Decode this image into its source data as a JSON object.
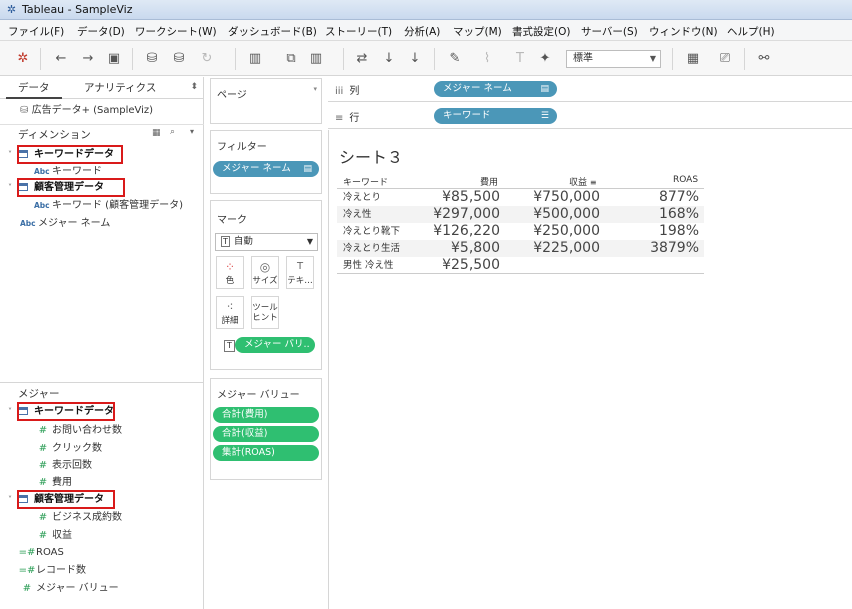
{
  "window": {
    "title": "Tableau - SampleViz"
  },
  "menu": [
    "ファイル(F)",
    "データ(D)",
    "ワークシート(W)",
    "ダッシュボード(B)",
    "ストーリー(T)",
    "分析(A)",
    "マップ(M)",
    "書式設定(O)",
    "サーバー(S)",
    "ウィンドウ(N)",
    "ヘルプ(H)"
  ],
  "toolbar": {
    "fit_mode": "標準"
  },
  "data_pane": {
    "tabs": [
      "データ",
      "アナリティクス"
    ],
    "datasource": "広告データ+ (SampleViz)",
    "dimensions_header": "ディメンション",
    "dimensions": {
      "table1": "キーワードデータ",
      "table1_field": "キーワード",
      "table2": "顧客管理データ",
      "table2_field": "キーワード (顧客管理データ)",
      "measure_names": "メジャー ネーム"
    },
    "measures_header": "メジャー",
    "measures": {
      "table1": "キーワードデータ",
      "table1_fields": [
        "お問い合わせ数",
        "クリック数",
        "表示回数",
        "費用"
      ],
      "table2": "顧客管理データ",
      "table2_fields": [
        "ビジネス成約数",
        "収益"
      ],
      "others": [
        "ROAS",
        "レコード数",
        "メジャー バリュー"
      ]
    }
  },
  "pages": {
    "title": "ページ"
  },
  "filters": {
    "title": "フィルター",
    "pill": "メジャー ネーム"
  },
  "marks": {
    "title": "マーク",
    "type": "自動",
    "buttons": {
      "color": "色",
      "size": "サイズ",
      "text": "テキ…",
      "detail": "詳細",
      "tooltip_1": "ツール",
      "tooltip_2": "ヒント"
    },
    "pill": "メジャー バリ.."
  },
  "measure_values_card": {
    "title": "メジャー バリュー",
    "pills": [
      "合計(費用)",
      "合計(収益)",
      "集計(ROAS)"
    ]
  },
  "shelves": {
    "columns_label": "列",
    "columns_pill": "メジャー ネーム",
    "rows_label": "行",
    "rows_pill": "キーワード"
  },
  "view": {
    "sheet_title": "シート３",
    "headers": {
      "keyword": "キーワード",
      "cost": "費用",
      "revenue": "収益",
      "roas": "ROAS"
    },
    "rows": [
      {
        "keyword": "冷えとり",
        "cost": "¥85,500",
        "revenue": "¥750,000",
        "roas": "877%"
      },
      {
        "keyword": "冷え性",
        "cost": "¥297,000",
        "revenue": "¥500,000",
        "roas": "168%"
      },
      {
        "keyword": "冷えとり靴下",
        "cost": "¥126,220",
        "revenue": "¥250,000",
        "roas": "198%"
      },
      {
        "keyword": "冷えとり生活",
        "cost": "¥5,800",
        "revenue": "¥225,000",
        "roas": "3879%"
      },
      {
        "keyword": "男性 冷え性",
        "cost": "¥25,500",
        "revenue": "",
        "roas": ""
      }
    ]
  }
}
